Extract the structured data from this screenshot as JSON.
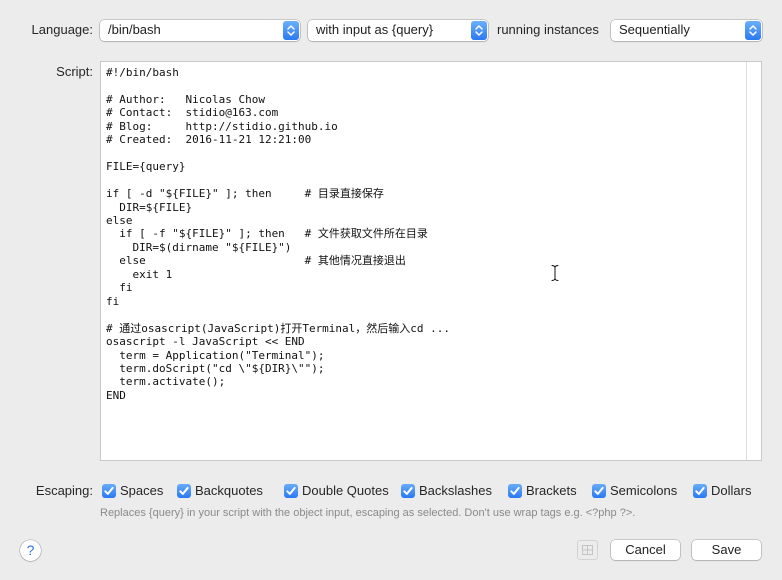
{
  "language": {
    "label": "Language:",
    "value": "/bin/bash"
  },
  "input_mode": {
    "value": "with input as {query}"
  },
  "running_instances": {
    "label": "running instances",
    "value": "Sequentially"
  },
  "script": {
    "label": "Script:",
    "content": "#!/bin/bash\n\n# Author:   Nicolas Chow\n# Contact:  stidio@163.com\n# Blog:     http://stidio.github.io\n# Created:  2016-11-21 12:21:00\n\nFILE={query}\n\nif [ -d \"${FILE}\" ]; then     # 目录直接保存\n  DIR=${FILE}\nelse\n  if [ -f \"${FILE}\" ]; then   # 文件获取文件所在目录\n    DIR=$(dirname \"${FILE}\")\n  else                        # 其他情况直接退出\n    exit 1\n  fi\nfi\n\n# 通过osascript(JavaScript)打开Terminal，然后输入cd ...\nosascript -l JavaScript << END\n  term = Application(\"Terminal\");\n  term.doScript(\"cd \\\"${DIR}\\\"\");\n  term.activate();\nEND"
  },
  "escaping": {
    "label": "Escaping:",
    "options": [
      {
        "label": "Spaces",
        "checked": true
      },
      {
        "label": "Backquotes",
        "checked": true
      },
      {
        "label": "Double Quotes",
        "checked": true
      },
      {
        "label": "Backslashes",
        "checked": true
      },
      {
        "label": "Brackets",
        "checked": true
      },
      {
        "label": "Semicolons",
        "checked": true
      },
      {
        "label": "Dollars",
        "checked": true
      }
    ],
    "help_text": "Replaces {query} in your script with the object input, escaping as selected. Don't use wrap tags e.g. <?php ?>."
  },
  "footer": {
    "help_label": "?",
    "cancel_label": "Cancel",
    "save_label": "Save"
  },
  "icons": {
    "popup_stepper": "up-down-chevron-icon",
    "checkbox_mark": "checkmark-icon",
    "template_button": "grid-icon",
    "mouse_cursor": "text-cursor-icon"
  },
  "colors": {
    "window_background": "#ececec",
    "accent": "#2a78f3",
    "help_text": "#8a8a8a"
  }
}
